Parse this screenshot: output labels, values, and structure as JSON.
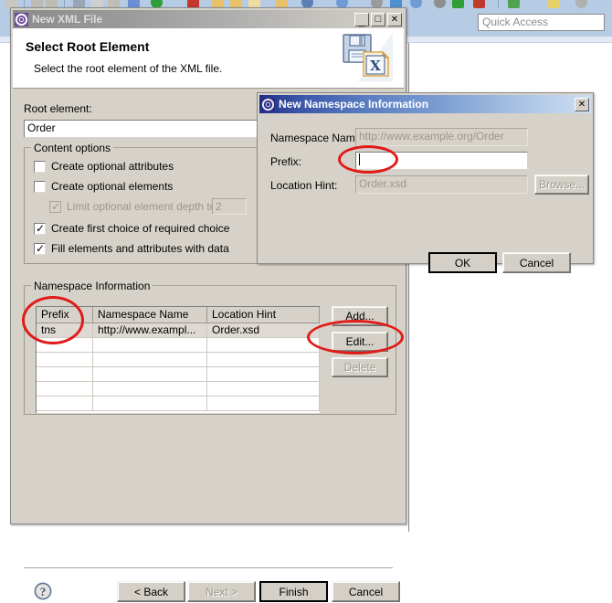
{
  "workbench": {
    "quick_access_placeholder": "Quick Access",
    "toolbar_icons": [
      "new-wizard-icon",
      "save-icon",
      "print-icon",
      "debug-icon",
      "run-icon",
      "external-tools-icon",
      "new-java-project-icon",
      "new-package-icon",
      "new-class-icon",
      "open-type-icon",
      "search-icon",
      "next-annotation-icon",
      "previous-annotation-icon",
      "last-edit-location-icon",
      "back-icon",
      "forward-icon",
      "pin-editor-icon",
      "toggle-mark-icon"
    ]
  },
  "wizard": {
    "window_title": "New XML File",
    "window_icon": "eclipse-wizard-icon",
    "minimize_label": "_",
    "maximize_label": "□",
    "close_label": "✕",
    "banner_icon": "xml-file-floppy-icon",
    "heading": "Select Root Element",
    "description": "Select the root element of the XML file.",
    "root_element_label": "Root element:",
    "root_element_value": "Order",
    "content_options": {
      "group_label": "Content options",
      "items": [
        {
          "label": "Create optional attributes",
          "checked": false,
          "enabled": true
        },
        {
          "label": "Create optional elements",
          "checked": false,
          "enabled": true
        },
        {
          "label": "Limit optional element depth to:",
          "checked": true,
          "enabled": false,
          "spinner_value": "2"
        },
        {
          "label": "Create first choice of required choice",
          "checked": true,
          "enabled": true
        },
        {
          "label": "Fill elements and attributes with data",
          "checked": true,
          "enabled": true
        }
      ]
    },
    "namespace_information": {
      "group_label": "Namespace Information",
      "columns": [
        "Prefix",
        "Namespace Name",
        "Location Hint"
      ],
      "rows": [
        [
          "tns",
          "http://www.exampl...",
          "Order.xsd"
        ],
        [
          "",
          "",
          ""
        ],
        [
          "",
          "",
          ""
        ],
        [
          "",
          "",
          ""
        ],
        [
          "",
          "",
          ""
        ],
        [
          "",
          "",
          ""
        ]
      ],
      "buttons": [
        {
          "label": "Add...",
          "enabled": true
        },
        {
          "label": "Edit...",
          "enabled": true
        },
        {
          "label": "Delete",
          "enabled": false
        }
      ]
    },
    "help_icon": "help-question-icon",
    "footer_buttons": [
      {
        "label": "< Back",
        "enabled": true,
        "default": false
      },
      {
        "label": "Next >",
        "enabled": false,
        "default": false
      },
      {
        "label": "Finish",
        "enabled": true,
        "default": true
      },
      {
        "label": "Cancel",
        "enabled": true,
        "default": false
      }
    ]
  },
  "namespace_dialog": {
    "window_title": "New Namespace Information",
    "window_icon": "eclipse-wizard-icon",
    "close_label": "✕",
    "fields": [
      {
        "label": "Namespace Name:",
        "value": "http://www.example.org/Order",
        "enabled": false
      },
      {
        "label": "Prefix:",
        "value": "",
        "enabled": true
      },
      {
        "label": "Location Hint:",
        "value": "Order.xsd",
        "enabled": false
      }
    ],
    "browse_button": {
      "label": "Browse...",
      "enabled": false
    },
    "ok_button": {
      "label": "OK",
      "default": true
    },
    "cancel_button": {
      "label": "Cancel",
      "default": false
    }
  },
  "annotations": {
    "color": "#e01b18",
    "ellipses": [
      "prefix-field-highlight",
      "prefix-column-highlight",
      "edit-button-highlight"
    ]
  }
}
